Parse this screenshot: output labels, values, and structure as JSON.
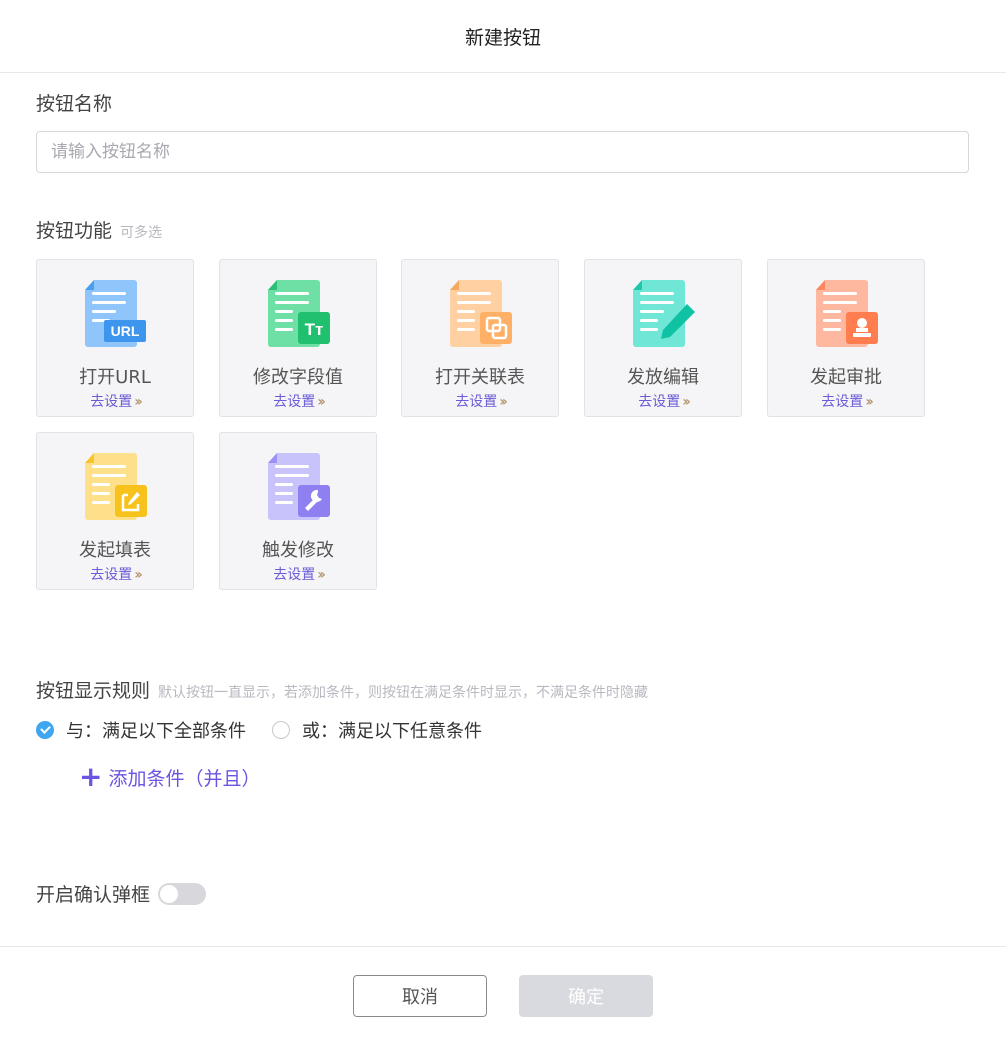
{
  "dialog": {
    "title": "新建按钮"
  },
  "name_section": {
    "label": "按钮名称",
    "placeholder": "请输入按钮名称",
    "value": ""
  },
  "function_section": {
    "label": "按钮功能",
    "hint": "可多选",
    "cards": [
      {
        "title": "打开URL",
        "setup": "去设置",
        "icon": "url-document-icon"
      },
      {
        "title": "修改字段值",
        "setup": "去设置",
        "icon": "text-field-document-icon"
      },
      {
        "title": "打开关联表",
        "setup": "去设置",
        "icon": "link-document-icon"
      },
      {
        "title": "发放编辑",
        "setup": "去设置",
        "icon": "edit-pen-document-icon"
      },
      {
        "title": "发起审批",
        "setup": "去设置",
        "icon": "approval-stamp-document-icon"
      },
      {
        "title": "发起填表",
        "setup": "去设置",
        "icon": "fill-form-document-icon"
      },
      {
        "title": "触发修改",
        "setup": "去设置",
        "icon": "wrench-document-icon"
      }
    ]
  },
  "rule_section": {
    "label": "按钮显示规则",
    "hint": "默认按钮一直显示，若添加条件，则按钮在满足条件时显示，不满足条件时隐藏",
    "options": [
      {
        "label": "与：满足以下全部条件",
        "checked": true
      },
      {
        "label": "或：满足以下任意条件",
        "checked": false
      }
    ],
    "add_condition": "添加条件（并且）"
  },
  "confirm_section": {
    "label": "开启确认弹框",
    "enabled": false
  },
  "footer": {
    "cancel": "取消",
    "ok": "确定"
  },
  "colors": {
    "accent": "#6a55e0",
    "radio_checked": "#3fa6f0",
    "link": "#6a5bd6"
  }
}
